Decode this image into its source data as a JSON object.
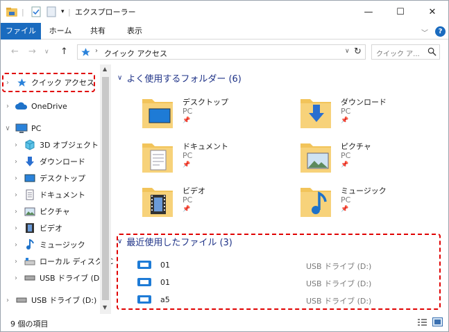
{
  "window": {
    "title": "エクスプローラー",
    "controls": {
      "minimize": "—",
      "maximize": "☐",
      "close": "✕"
    }
  },
  "ribbon": {
    "tabs": [
      {
        "label": "ファイル"
      },
      {
        "label": "ホーム"
      },
      {
        "label": "共有"
      },
      {
        "label": "表示"
      }
    ],
    "help": "?"
  },
  "address": {
    "path": "クイック アクセス",
    "search_placeholder": "クイック ア..."
  },
  "nav": {
    "items": [
      {
        "label": "クイック アクセス",
        "icon": "star-icon"
      },
      {
        "label": "OneDrive",
        "icon": "cloud-icon"
      },
      {
        "label": "PC",
        "icon": "pc-icon"
      },
      {
        "label": "3D オブジェクト",
        "icon": "cube-icon"
      },
      {
        "label": "ダウンロード",
        "icon": "download-icon"
      },
      {
        "label": "デスクトップ",
        "icon": "desktop-icon"
      },
      {
        "label": "ドキュメント",
        "icon": "document-icon"
      },
      {
        "label": "ピクチャ",
        "icon": "picture-icon"
      },
      {
        "label": "ビデオ",
        "icon": "video-icon"
      },
      {
        "label": "ミュージック",
        "icon": "music-icon"
      },
      {
        "label": "ローカル ディスク (C",
        "icon": "disk-icon"
      },
      {
        "label": "USB ドライブ (D:)",
        "icon": "usb-icon"
      },
      {
        "label": "USB ドライブ (D:)",
        "icon": "usb-icon"
      }
    ]
  },
  "frequent": {
    "header": "よく使用するフォルダー (6)",
    "folders": [
      {
        "name": "デスクトップ",
        "sub": "PC",
        "icon": "desktop-folder-icon"
      },
      {
        "name": "ダウンロード",
        "sub": "PC",
        "icon": "download-folder-icon"
      },
      {
        "name": "ドキュメント",
        "sub": "PC",
        "icon": "document-folder-icon"
      },
      {
        "name": "ピクチャ",
        "sub": "PC",
        "icon": "picture-folder-icon"
      },
      {
        "name": "ビデオ",
        "sub": "PC",
        "icon": "video-folder-icon"
      },
      {
        "name": "ミュージック",
        "sub": "PC",
        "icon": "music-folder-icon"
      }
    ]
  },
  "recent": {
    "header": "最近使用したファイル (3)",
    "files": [
      {
        "name": "01",
        "location": "USB ドライブ (D:)"
      },
      {
        "name": "01",
        "location": "USB ドライブ (D:)"
      },
      {
        "name": "a5",
        "location": "USB ドライブ (D:)"
      }
    ]
  },
  "status": {
    "text": "9 個の項目"
  },
  "colors": {
    "accent": "#1a6bbf",
    "highlight": "#e00000",
    "folder": "#f2c45a"
  }
}
